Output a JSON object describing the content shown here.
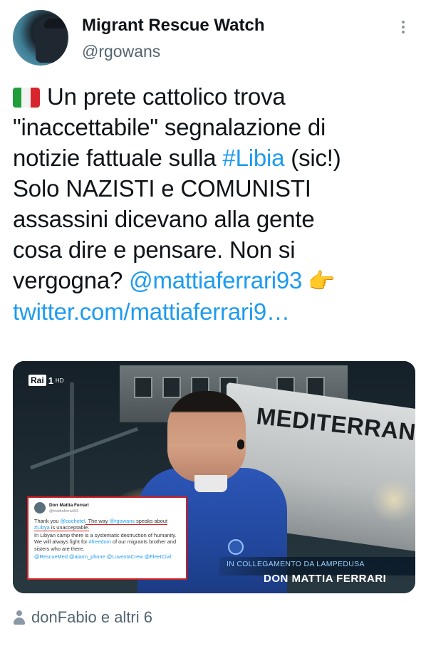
{
  "author": {
    "display_name": "Migrant Rescue Watch",
    "handle": "@rgowans"
  },
  "tweet": {
    "flag_icon": "italy-flag-icon",
    "line1": "Un prete cattolico trova",
    "line2": "\"inaccettabile\" segnalazione di",
    "line3_pre": "notizie fattuale sulla ",
    "hashtag": "#Libia",
    "line3_post": " (sic!)",
    "line4": "Solo NAZISTI e COMUNISTI",
    "line5": "assassini dicevano alla gente",
    "line6": "cosa dire e pensare. Non si",
    "line7_pre": "vergogna? ",
    "mention": "@mattiaferrari93",
    "emoji": "👉",
    "url": "twitter.com/mattiaferrari9…"
  },
  "media": {
    "channel_logo_box": "Rai",
    "channel_logo_num": "1",
    "channel_logo_hd": "HD",
    "ship_name": "MEDITERRANEA",
    "embedded_tweet": {
      "name": "Don Mattia Ferrari",
      "handle": "@mattiaferrari93",
      "p1_a": "Thank you ",
      "p1_mention1": "@cochetel",
      "p1_b": ". The way ",
      "p1_mention2": "@rgowans",
      "p1_c": " speaks about ",
      "p1_tag": "#Libya",
      "p1_d": " is unacceptable.",
      "p2_a": "In Libyan camp there is a systematic destruction of humanity. We will always fight for ",
      "p2_tag": "#freedom",
      "p2_b": " of our migrants brother and sisters who are there.",
      "p3": "@RescueMed @alarm_phone @LuventaCrew @FleetCivil"
    },
    "caption_top": "IN COLLEGAMENTO DA LAMPEDUSA",
    "caption_main": "DON MATTIA FERRARI"
  },
  "social_context": {
    "icon": "person-icon",
    "text": "donFabio e altri 6"
  },
  "colors": {
    "link": "#1d9bf0",
    "secondary_text": "#536471",
    "primary_text": "#0f1419"
  }
}
